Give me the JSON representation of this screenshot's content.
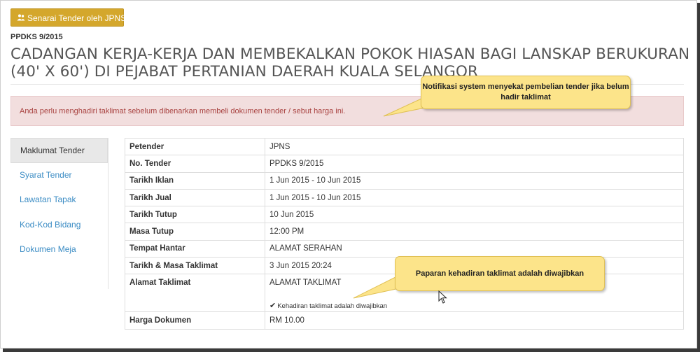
{
  "header": {
    "list_button_label": "Senarai Tender oleh JPNS",
    "reference": "PPDKS 9/2015",
    "title": "CADANGAN KERJA-KERJA DAN MEMBEKALKAN POKOK HIASAN BAGI LANSKAP BERUKURAN (40' X 60') DI PEJABAT PERTANIAN DAERAH KUALA SELANGOR"
  },
  "alert": {
    "message": "Anda perlu menghadiri taklimat sebelum dibenarkan membeli dokumen tender / sebut harga ini."
  },
  "callouts": {
    "notification": "Notifikasi system menyekat pembelian tender jika belum hadir taklimat",
    "attendance": "Paparan kehadiran taklimat adalah diwajibkan"
  },
  "sidebar": {
    "items": [
      {
        "label": "Maklumat Tender"
      },
      {
        "label": "Syarat Tender"
      },
      {
        "label": "Lawatan Tapak"
      },
      {
        "label": "Kod-Kod Bidang"
      },
      {
        "label": "Dokumen Meja"
      }
    ]
  },
  "details": {
    "rows": [
      {
        "label": "Petender",
        "value": "JPNS"
      },
      {
        "label": "No. Tender",
        "value": "PPDKS 9/2015"
      },
      {
        "label": "Tarikh Iklan",
        "value": "1 Jun 2015 - 10 Jun 2015"
      },
      {
        "label": "Tarikh Jual",
        "value": "1 Jun 2015 - 10 Jun 2015"
      },
      {
        "label": "Tarikh Tutup",
        "value": "10 Jun 2015"
      },
      {
        "label": "Masa Tutup",
        "value": "12:00 PM"
      },
      {
        "label": "Tempat Hantar",
        "value": "ALAMAT SERAHAN"
      },
      {
        "label": "Tarikh & Masa Taklimat",
        "value": "3 Jun 2015 20:24"
      },
      {
        "label": "Alamat Taklimat",
        "value": "ALAMAT TAKLIMAT",
        "note": "Kehadiran taklimat adalah diwajibkan"
      },
      {
        "label": "Harga Dokumen",
        "value": "RM 10.00"
      }
    ]
  },
  "colors": {
    "button": "#d4a72c",
    "alert_bg": "#f2dede",
    "alert_text": "#a94442",
    "callout": "#fce48a",
    "link": "#3b8cc4"
  },
  "icons": {
    "list_button": "users-icon",
    "attendance_note": "check-icon",
    "pointer": "mouse-cursor-icon"
  }
}
